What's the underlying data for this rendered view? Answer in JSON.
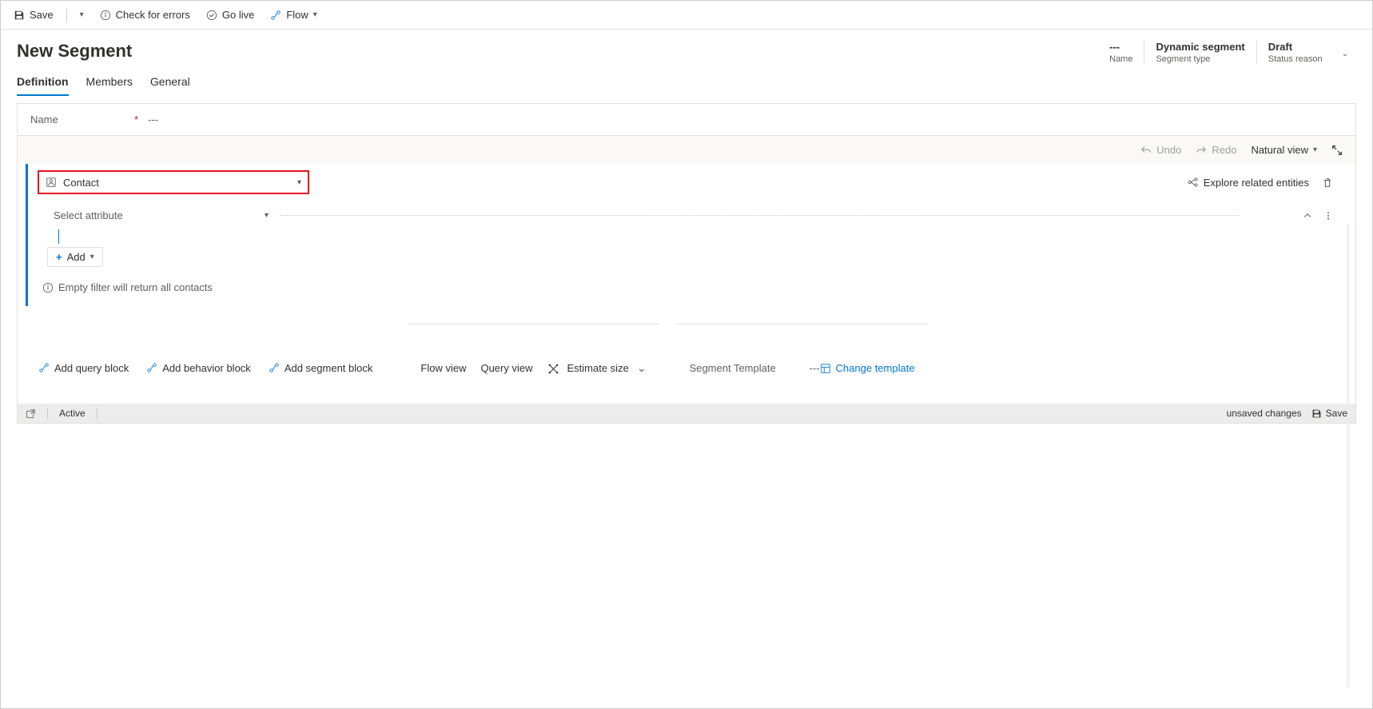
{
  "toolbar": {
    "save": "Save",
    "check_errors": "Check for errors",
    "go_live": "Go live",
    "flow": "Flow"
  },
  "header": {
    "title": "New Segment",
    "meta": [
      {
        "value": "---",
        "label": "Name"
      },
      {
        "value": "Dynamic segment",
        "label": "Segment type"
      },
      {
        "value": "Draft",
        "label": "Status reason"
      }
    ]
  },
  "tabs": {
    "definition": "Definition",
    "members": "Members",
    "general": "General"
  },
  "name_field": {
    "label": "Name",
    "value": "---"
  },
  "designer_bar": {
    "undo": "Undo",
    "redo": "Redo",
    "view": "Natural view"
  },
  "block": {
    "entity": "Contact",
    "explore": "Explore related entities",
    "select_attribute": "Select attribute",
    "add": "Add",
    "hint": "Empty filter will return all contacts"
  },
  "add_blocks": {
    "query": "Add query block",
    "behavior": "Add behavior block",
    "segment": "Add segment block"
  },
  "bottom": {
    "flow_view": "Flow view",
    "query_view": "Query view",
    "estimate": "Estimate size"
  },
  "template": {
    "label": "Segment Template",
    "value": "---",
    "change": "Change template"
  },
  "statusbar": {
    "active": "Active",
    "unsaved": "unsaved changes",
    "save": "Save"
  }
}
